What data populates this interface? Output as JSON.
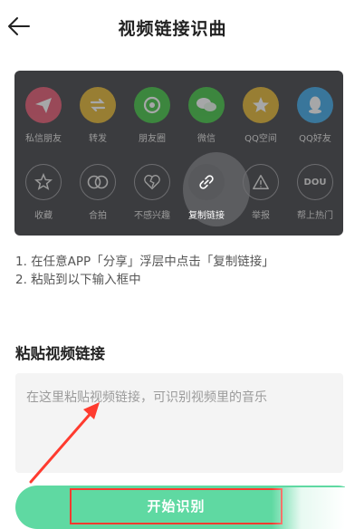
{
  "header": {
    "title": "视频链接识曲"
  },
  "share_panel": {
    "row1": [
      {
        "icon": "paper-plane-icon",
        "label": "私信朋友",
        "color": "#e8556e"
      },
      {
        "icon": "repost-icon",
        "label": "转发",
        "color": "#e5b52a"
      },
      {
        "icon": "camera-lens-icon",
        "label": "朋友圈",
        "color": "#3ec43e"
      },
      {
        "icon": "wechat-icon",
        "label": "微信",
        "color": "#3ec43e"
      },
      {
        "icon": "qzone-star-icon",
        "label": "QQ空间",
        "color": "#e5b52a"
      },
      {
        "icon": "qq-icon",
        "label": "QQ好友",
        "color": "#3aa7e8"
      }
    ],
    "row2": [
      {
        "icon": "star-icon",
        "label": "收藏"
      },
      {
        "icon": "duet-icon",
        "label": "合拍"
      },
      {
        "icon": "broken-heart-icon",
        "label": "不感兴趣"
      },
      {
        "icon": "link-icon",
        "label": "复制链接"
      },
      {
        "icon": "warning-icon",
        "label": "举报"
      },
      {
        "icon": "dou-icon",
        "label": "帮上热门"
      }
    ],
    "dou_text": "DOU"
  },
  "instructions": {
    "step1": "1. 在任意APP「分享」浮层中点击「复制链接」",
    "step2": "2. 粘贴到以下输入框中"
  },
  "link_input": {
    "label": "粘贴视频链接",
    "placeholder": "在这里粘贴视频链接，可识别视频里的音乐",
    "value": ""
  },
  "start_button": {
    "label": "开始识别",
    "color": "#5fd9a2"
  },
  "annotation_color": "#ff3b2f"
}
